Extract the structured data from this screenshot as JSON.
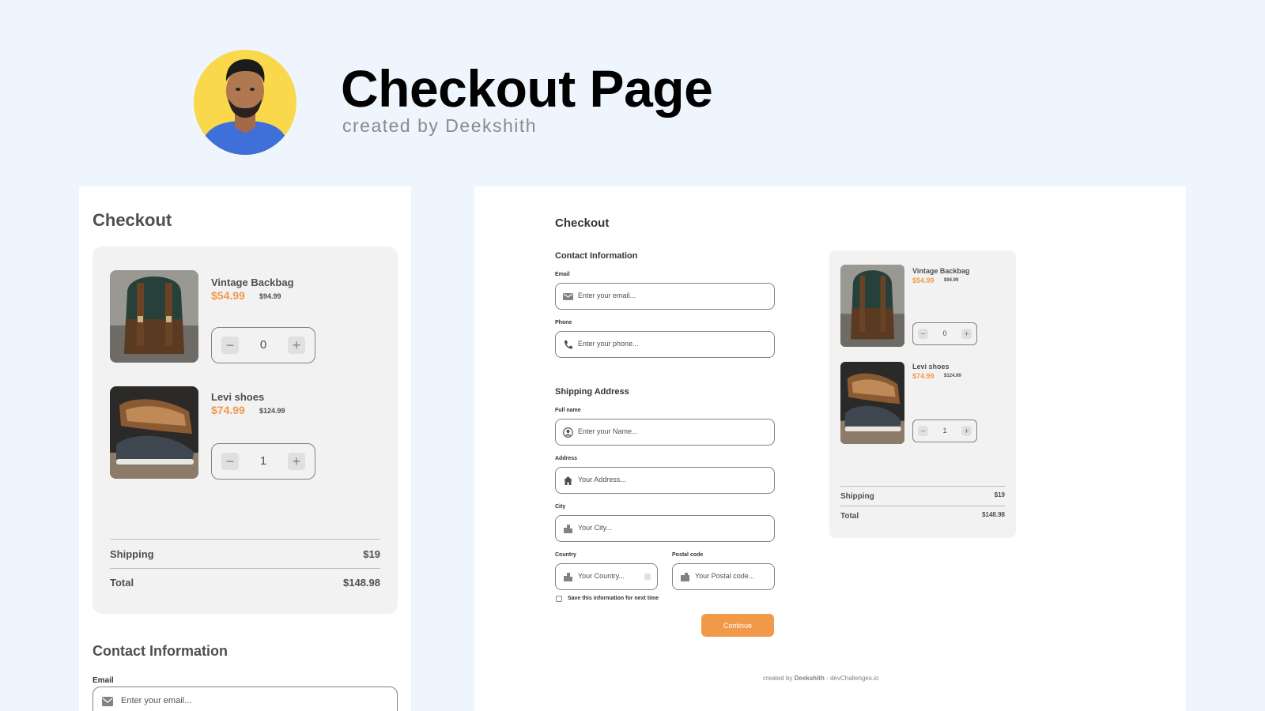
{
  "hero": {
    "title": "Checkout Page",
    "subtitle": "created by Deekshith"
  },
  "colors": {
    "background": "#eef5fd",
    "accent": "#f2994a",
    "avatar_bg": "#f9d84b",
    "cart_bg": "#f2f2f2"
  },
  "mobile": {
    "title": "Checkout",
    "cart": {
      "items": [
        {
          "name": "Vintage Backbag",
          "price": "$54.99",
          "old_price": "$94.99",
          "qty": "0"
        },
        {
          "name": "Levi shoes",
          "price": "$74.99",
          "old_price": "$124.99",
          "qty": "1"
        }
      ],
      "shipping_label": "Shipping",
      "shipping_value": "$19",
      "total_label": "Total",
      "total_value": "$148.98"
    },
    "contact": {
      "title": "Contact Information",
      "email_label": "Email",
      "email_placeholder": "Enter your email..."
    }
  },
  "desktop": {
    "title": "Checkout",
    "contact": {
      "title": "Contact Information",
      "email_label": "Email",
      "email_placeholder": "Enter your email...",
      "phone_label": "Phone",
      "phone_placeholder": "Enter your phone..."
    },
    "shipping": {
      "title": "Shipping Address",
      "name_label": "Full name",
      "name_placeholder": "Enter your Name...",
      "address_label": "Address",
      "address_placeholder": "Your Address...",
      "city_label": "City",
      "city_placeholder": "Your City...",
      "country_label": "Country",
      "country_placeholder": "Your Country...",
      "postal_label": "Postal code",
      "postal_placeholder": "Your Postal code..."
    },
    "save_label": "Save this information for next time",
    "continue_label": "Continue",
    "footer_prefix": "created by",
    "footer_author": "Deekshith",
    "footer_suffix": "- devChallenges.io",
    "cart": {
      "items": [
        {
          "name": "Vintage Backbag",
          "price": "$54.99",
          "old_price": "$94.99",
          "qty": "0"
        },
        {
          "name": "Levi shoes",
          "price": "$74.99",
          "old_price": "$124.99",
          "qty": "1"
        }
      ],
      "shipping_label": "Shipping",
      "shipping_value": "$19",
      "total_label": "Total",
      "total_value": "$148.98"
    }
  },
  "icons": {
    "email": "mail-icon",
    "phone": "phone-icon",
    "name": "user-icon",
    "address": "home-icon",
    "city": "city-icon",
    "country": "city-icon",
    "postal": "mailbox-icon",
    "minus": "minus-icon",
    "plus": "plus-icon"
  }
}
